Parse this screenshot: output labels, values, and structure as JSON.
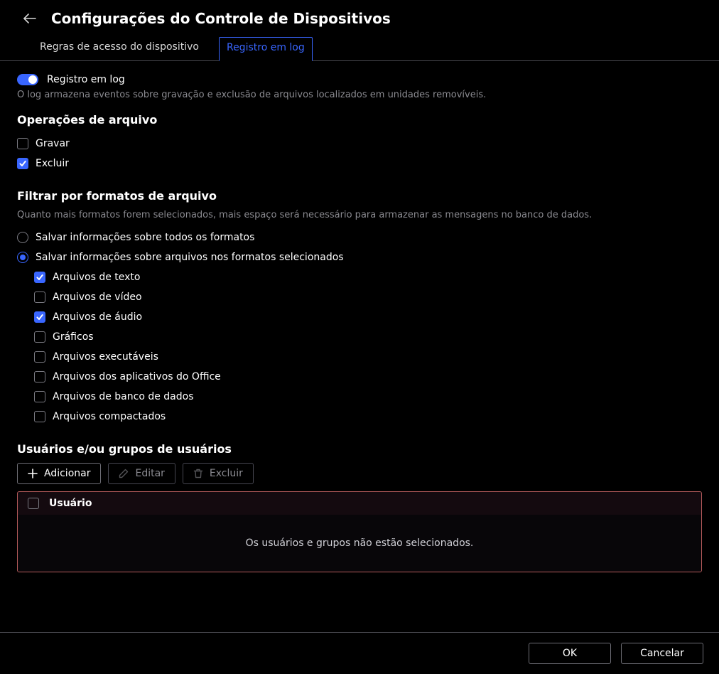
{
  "header": {
    "title": "Configurações do Controle de Dispositivos"
  },
  "tabs": {
    "rules": "Regras de acesso do dispositivo",
    "logging": "Registro em log"
  },
  "logging": {
    "label": "Registro em log",
    "hint": "O log armazena eventos sobre gravação e exclusão de arquivos localizados em unidades removíveis.",
    "enabled": true
  },
  "file_ops": {
    "title": "Operações de arquivo",
    "write": {
      "label": "Gravar",
      "checked": false
    },
    "delete": {
      "label": "Excluir",
      "checked": true
    }
  },
  "formats_filter": {
    "title": "Filtrar por formatos de arquivo",
    "hint": "Quanto mais formatos forem selecionados, mais espaço será necessário para armazenar as mensagens no banco de dados.",
    "radio_all": "Salvar informações sobre todos os formatos",
    "radio_selected": "Salvar informações sobre arquivos nos formatos selecionados",
    "selected_mode": "selected",
    "items": [
      {
        "label": "Arquivos de texto",
        "checked": true
      },
      {
        "label": "Arquivos de vídeo",
        "checked": false
      },
      {
        "label": "Arquivos de áudio",
        "checked": true
      },
      {
        "label": "Gráficos",
        "checked": false
      },
      {
        "label": "Arquivos executáveis",
        "checked": false
      },
      {
        "label": "Arquivos dos aplicativos do Office",
        "checked": false
      },
      {
        "label": "Arquivos de banco de dados",
        "checked": false
      },
      {
        "label": "Arquivos compactados",
        "checked": false
      }
    ]
  },
  "users": {
    "title": "Usuários e/ou grupos de usuários",
    "toolbar": {
      "add": "Adicionar",
      "edit": "Editar",
      "delete": "Excluir"
    },
    "column_user": "Usuário",
    "empty_msg": "Os usuários e grupos não estão selecionados."
  },
  "footer": {
    "ok": "OK",
    "cancel": "Cancelar"
  }
}
